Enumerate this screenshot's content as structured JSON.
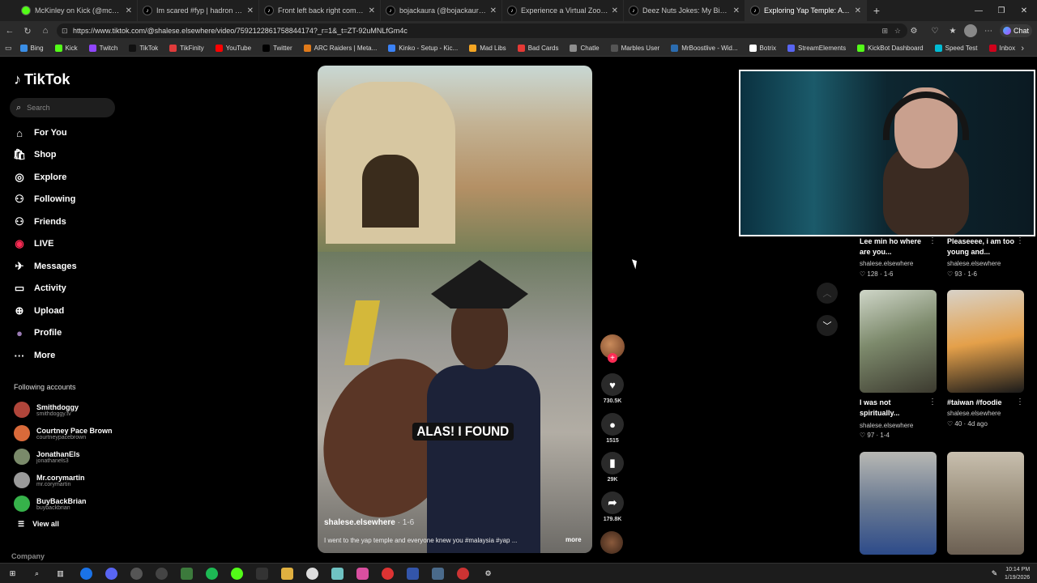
{
  "browser": {
    "tabs": [
      {
        "title": "McKinley on Kick (@mckinley.tv) | ..."
      },
      {
        "title": "Im scared #fyp | hadron collider w..."
      },
      {
        "title": "Front left back right combo 💙 | Ir..."
      },
      {
        "title": "bojackaura (@bojackaura)'s video..."
      },
      {
        "title": "Experience a Virtual Zoo Adventur..."
      },
      {
        "title": "Deez Nuts Jokes: My Biggest Dow..."
      },
      {
        "title": "Exploring Yap Temple: A Solo Trav..."
      }
    ],
    "url": "https://www.tiktok.com/@shalese.elsewhere/video/7592122861758844174?_r=1&_t=ZT-92uMNLfGm4c",
    "copilot_label": "Chat",
    "bookmarks": [
      "Bing",
      "Kick",
      "Twitch",
      "TikTok",
      "TikFinity",
      "YouTube",
      "Twitter",
      "ARC Raiders | Meta...",
      "Kinko - Setup - Kic...",
      "Mad Libs",
      "Bad Cards",
      "Chatle",
      "Marbles User",
      "MrBoostlive - Wid...",
      "Botrix",
      "StreamElements",
      "KickBot Dashboard",
      "Speed Test",
      "Inbox"
    ],
    "bookmark_colors": [
      "#3a8ee6",
      "#53fc18",
      "#9146ff",
      "#111111",
      "#e03b3b",
      "#ff0000",
      "#000000",
      "#e07a1a",
      "#3b82f6",
      "#f5a623",
      "#e53935",
      "#8e8e8e",
      "#555555",
      "#2b6cb0",
      "#ffffff",
      "#5865f2",
      "#53fc18",
      "#00bcd4",
      "#d0021b"
    ]
  },
  "sidebar": {
    "logo": "TikTok",
    "search_placeholder": "Search",
    "nav": [
      {
        "label": "For You",
        "icon": "home-icon"
      },
      {
        "label": "Shop",
        "icon": "shop-icon"
      },
      {
        "label": "Explore",
        "icon": "compass-icon"
      },
      {
        "label": "Following",
        "icon": "following-icon"
      },
      {
        "label": "Friends",
        "icon": "friends-icon"
      },
      {
        "label": "LIVE",
        "icon": "live-icon"
      },
      {
        "label": "Messages",
        "icon": "messages-icon"
      },
      {
        "label": "Activity",
        "icon": "activity-icon"
      },
      {
        "label": "Upload",
        "icon": "upload-icon"
      },
      {
        "label": "Profile",
        "icon": "profile-icon"
      },
      {
        "label": "More",
        "icon": "more-icon"
      }
    ],
    "following_title": "Following accounts",
    "following": [
      {
        "name": "Smithdoggy",
        "handle": "smithdoggy.tv",
        "color": "#b0453a"
      },
      {
        "name": "Courtney Pace Brown",
        "handle": "courtneypacebrown",
        "color": "#d96a3a"
      },
      {
        "name": "JonathanEls",
        "handle": "jonathanels3",
        "color": "#7a8a6a"
      },
      {
        "name": "Mr.corymartin",
        "handle": "mr.corymartin",
        "color": "#9a9a9a"
      },
      {
        "name": "BuyBackBrian",
        "handle": "buybackbrian",
        "color": "#36b24a"
      }
    ],
    "view_all": "View all",
    "company": "Company"
  },
  "video": {
    "caption_overlay": "ALAS! I FOUND",
    "author": "shalese.elsewhere",
    "date": "· 1-6",
    "description": "I went to the yap temple and everyone knew you #malaysia #yap ...",
    "more": "more"
  },
  "actions": {
    "likes": "730.5K",
    "comments": "1515",
    "saves": "29K",
    "shares": "179.8K"
  },
  "related": [
    {
      "title": "Lee min ho where are you...",
      "author": "shalese.elsewhere",
      "likes": "128",
      "date": "1-6"
    },
    {
      "title": "Pleaseeee, i am too young and...",
      "author": "shalese.elsewhere",
      "likes": "93",
      "date": "1-6"
    },
    {
      "title": "I was not spiritually...",
      "author": "shalese.elsewhere",
      "likes": "97",
      "date": "1-4"
    },
    {
      "title": "#taiwan #foodie",
      "author": "shalese.elsewhere",
      "likes": "40",
      "date": "4d ago"
    }
  ],
  "taskbar": {
    "time": "10:14 PM",
    "date": "1/19/2026"
  }
}
